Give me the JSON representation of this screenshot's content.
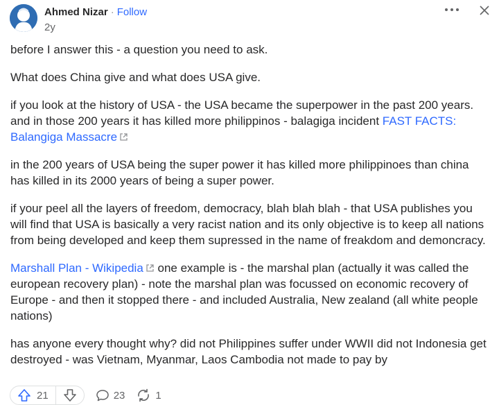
{
  "author": {
    "name": "Ahmed Nizar",
    "separator": "·",
    "follow_label": "Follow",
    "age": "2y"
  },
  "header_icons": {
    "more": "more-options-icon",
    "close": "close-icon"
  },
  "answer": {
    "p1": "before I answer this - a question you need to ask.",
    "p2": "What does China give and what does USA give.",
    "p3_text": "if you look at the history of USA - the USA became the superpower in the past 200 years. and in those 200 years it has killed more philippinos - balagiga incident ",
    "p3_link": "FAST FACTS: Balangiga Massacre",
    "p4": "in the 200 years of USA being the super power it has killed more philippinoes than china has killed in its 2000 years of being a super power.",
    "p5": "if your peel all the layers of freedom, democracy, blah blah blah - that USA publishes you will find that USA is basically a very racist nation and its only objective is to keep all nations from being developed and keep them supressed in the name of freakdom and demoncracy.",
    "p6_link": "Marshall Plan - Wikipedia",
    "p6_text": " one example is - the marshal plan (actually it was called the european recovery plan) - note the marshal plan was focussed on economic recovery of Europe - and then it stopped there - and included Australia, New zealand (all white people nations)",
    "p7": "has anyone every thought why? did not Philippines suffer under WWII did not Indonesia get destroyed - was Vietnam, Myanmar, Laos Cambodia not made to pay by"
  },
  "actions": {
    "upvotes": "21",
    "comments": "23",
    "shares": "1"
  },
  "colors": {
    "link": "#2e69ff",
    "text": "#282829",
    "muted": "#636466",
    "border": "#dee0e1"
  }
}
